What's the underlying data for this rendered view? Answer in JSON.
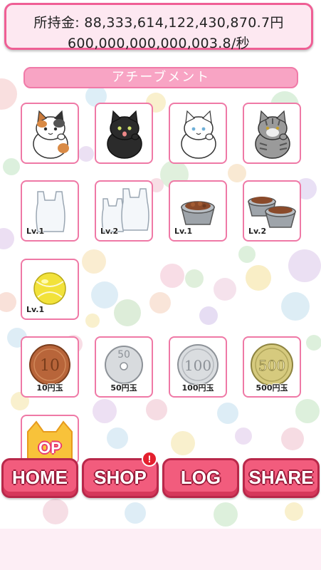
{
  "money": {
    "line1": "所持金: 88,333,614,122,430,870.7円",
    "line2": "600,000,000,000,003.8/秒"
  },
  "achievements": {
    "title": "アチーブメント",
    "cats": [
      {
        "name": "calico-cat"
      },
      {
        "name": "black-cat"
      },
      {
        "name": "white-cat"
      },
      {
        "name": "gray-tabby-cat"
      }
    ],
    "items": [
      {
        "name": "plastic-bag",
        "level": "Lv.1"
      },
      {
        "name": "plastic-bags",
        "level": "Lv.2"
      },
      {
        "name": "cat-food-bowl",
        "level": "Lv.1"
      },
      {
        "name": "cat-food-bowls",
        "level": "Lv.2"
      }
    ],
    "toy": {
      "name": "yellow-ball",
      "level": "Lv.1"
    },
    "coins": [
      {
        "label": "10円玉",
        "value": "10"
      },
      {
        "label": "50円玉",
        "value": "50"
      },
      {
        "label": "100円玉",
        "value": "100"
      },
      {
        "label": "500円玉",
        "value": "500"
      }
    ],
    "op_tile": {
      "text": "OP"
    }
  },
  "nav": {
    "home": "HOME",
    "shop": "SHOP",
    "log": "LOG",
    "share": "SHARE",
    "shop_badge": "!"
  },
  "colors": {
    "accent_pink": "#ef5f95",
    "button_red": "#f25c7d",
    "badge_red": "#e4202e"
  }
}
